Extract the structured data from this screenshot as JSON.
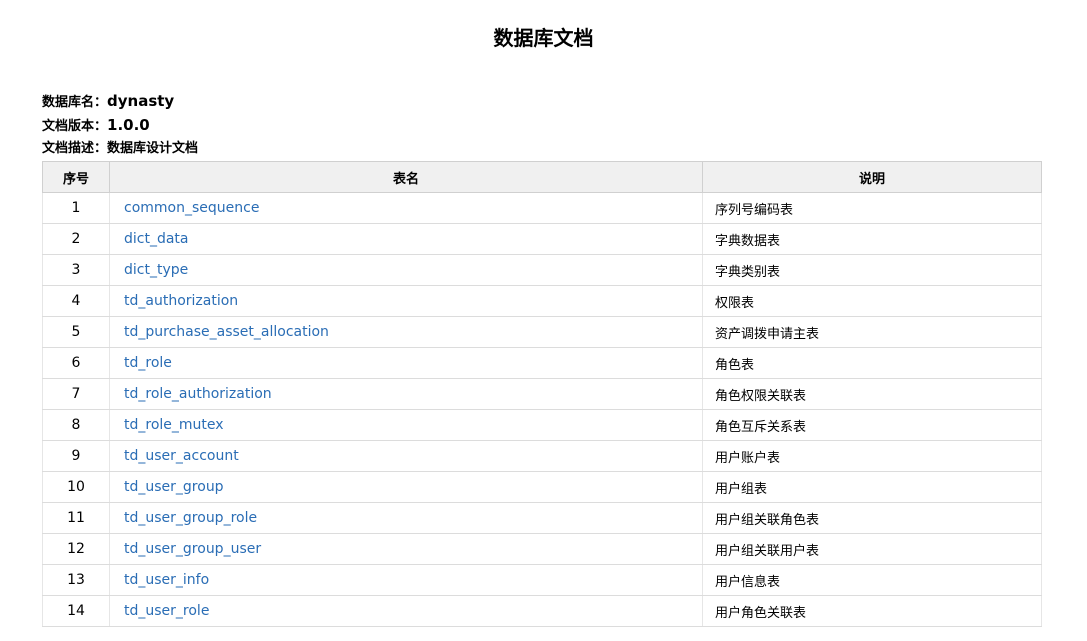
{
  "title": "数据库文档",
  "meta": {
    "db_name_label": "数据库名：",
    "db_name": "dynasty",
    "version_label": "文档版本：",
    "version": "1.0.0",
    "desc_label": "文档描述：",
    "desc": "数据库设计文档"
  },
  "table": {
    "headers": [
      "序号",
      "表名",
      "说明"
    ],
    "rows": [
      {
        "no": "1",
        "name": "common_sequence",
        "desc": "序列号编码表"
      },
      {
        "no": "2",
        "name": "dict_data",
        "desc": "字典数据表"
      },
      {
        "no": "3",
        "name": "dict_type",
        "desc": "字典类别表"
      },
      {
        "no": "4",
        "name": "td_authorization",
        "desc": "权限表"
      },
      {
        "no": "5",
        "name": "td_purchase_asset_allocation",
        "desc": "资产调拨申请主表"
      },
      {
        "no": "6",
        "name": "td_role",
        "desc": "角色表"
      },
      {
        "no": "7",
        "name": "td_role_authorization",
        "desc": "角色权限关联表"
      },
      {
        "no": "8",
        "name": "td_role_mutex",
        "desc": "角色互斥关系表"
      },
      {
        "no": "9",
        "name": "td_user_account",
        "desc": "用户账户表"
      },
      {
        "no": "10",
        "name": "td_user_group",
        "desc": "用户组表"
      },
      {
        "no": "11",
        "name": "td_user_group_role",
        "desc": "用户组关联角色表"
      },
      {
        "no": "12",
        "name": "td_user_group_user",
        "desc": "用户组关联用户表"
      },
      {
        "no": "13",
        "name": "td_user_info",
        "desc": "用户信息表"
      },
      {
        "no": "14",
        "name": "td_user_role",
        "desc": "用户角色关联表"
      }
    ]
  },
  "colors": {
    "link": "#2a6db5",
    "header_bg": "#f0f0f0"
  }
}
